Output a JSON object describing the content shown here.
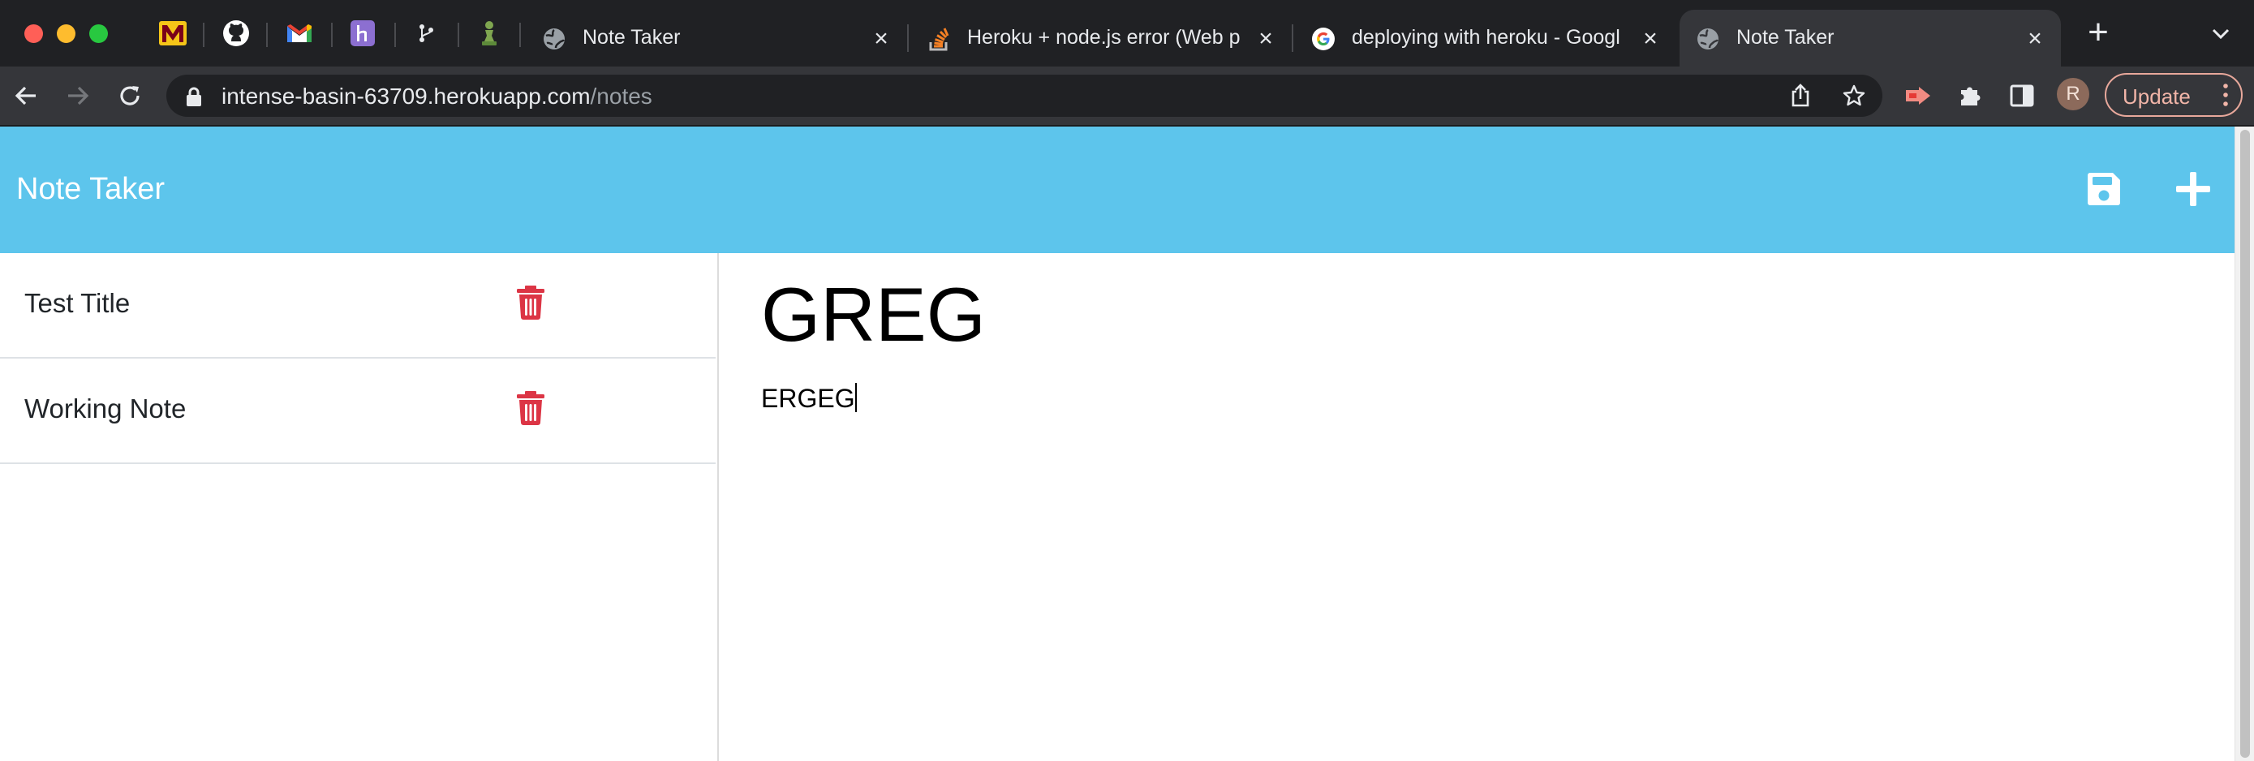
{
  "browser": {
    "tabs": [
      {
        "title": "Note Taker",
        "favicon": "globe-icon",
        "active": false
      },
      {
        "title": "Heroku + node.js error (Web p",
        "favicon": "stackoverflow-icon",
        "active": false
      },
      {
        "title": "deploying with heroku - Googl",
        "favicon": "google-icon",
        "active": false
      },
      {
        "title": "Note Taker",
        "favicon": "globe-icon",
        "active": true
      }
    ],
    "pinned_tabs": [
      "minnesota-icon",
      "github-icon",
      "gmail-icon",
      "heroku-icon",
      "git-icon",
      "chess-icon"
    ],
    "url_host": "intense-basin-63709.herokuapp.com",
    "url_path": "/notes",
    "avatar_letter": "R",
    "update_label": "Update"
  },
  "app": {
    "brand": "Note Taker",
    "notes": [
      {
        "title": "Test Title"
      },
      {
        "title": "Working Note"
      }
    ],
    "active_note": {
      "title": "GREG",
      "text": "ERGEG"
    }
  },
  "colors": {
    "header": "#5dc5ec",
    "delete_icon": "#dc3545",
    "chrome_dark": "#202124",
    "chrome_toolbar": "#35363a"
  }
}
